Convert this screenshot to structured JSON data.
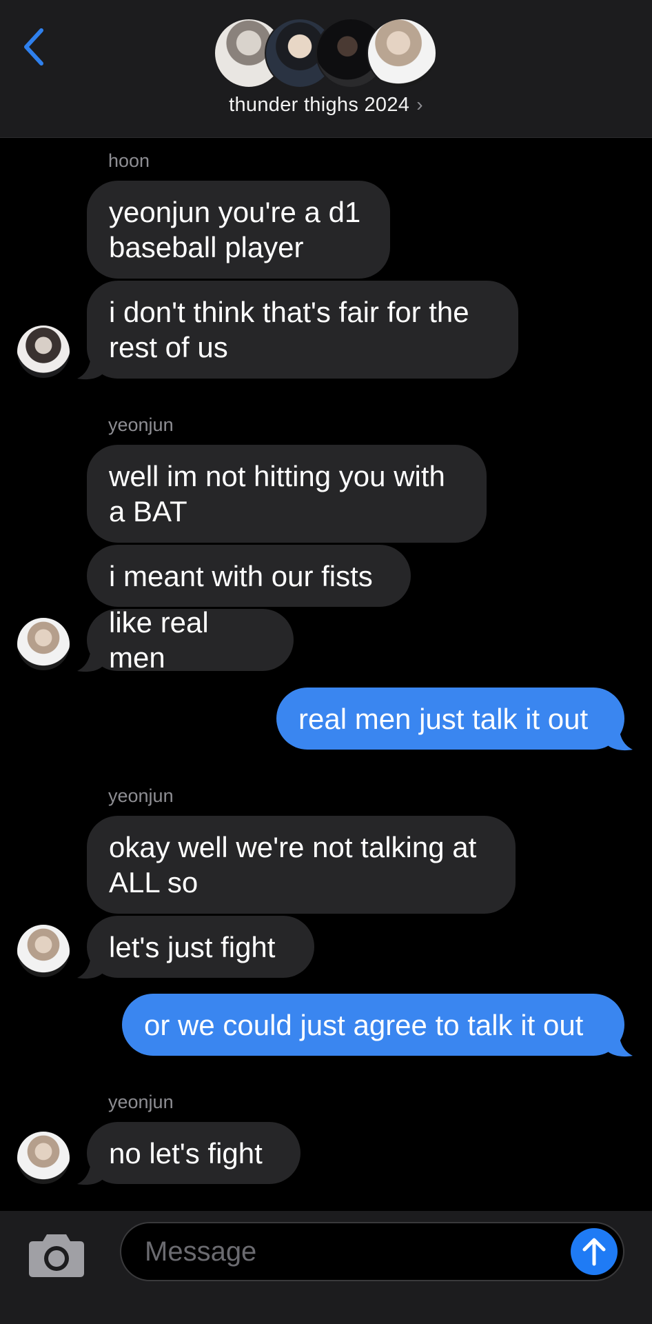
{
  "header": {
    "group_name": "thunder thighs 2024",
    "avatar_icons": [
      "member-avatar-1",
      "member-avatar-2",
      "member-avatar-3",
      "member-avatar-4"
    ]
  },
  "messages": [
    {
      "sender": "hoon",
      "direction": "incoming",
      "bubbles": [
        "yeonjun you're a d1 baseball player",
        "i don't think that's fair for the rest of us"
      ]
    },
    {
      "sender": "yeonjun",
      "direction": "incoming",
      "bubbles": [
        "well im not hitting you with a BAT",
        "i meant with our fists",
        "like real men"
      ]
    },
    {
      "direction": "outgoing",
      "bubbles": [
        "real men just talk it out"
      ]
    },
    {
      "sender": "yeonjun",
      "direction": "incoming",
      "bubbles": [
        "okay well we're not talking at ALL so",
        "let's just fight"
      ]
    },
    {
      "direction": "outgoing",
      "bubbles": [
        "or we could just agree to talk it out"
      ]
    },
    {
      "sender": "yeonjun",
      "direction": "incoming",
      "bubbles": [
        "no let's fight"
      ]
    }
  ],
  "composer": {
    "placeholder": "Message"
  },
  "colors": {
    "incoming_bubble": "#262628",
    "outgoing_bubble": "#3a86f0",
    "accent": "#1f7bf5"
  }
}
